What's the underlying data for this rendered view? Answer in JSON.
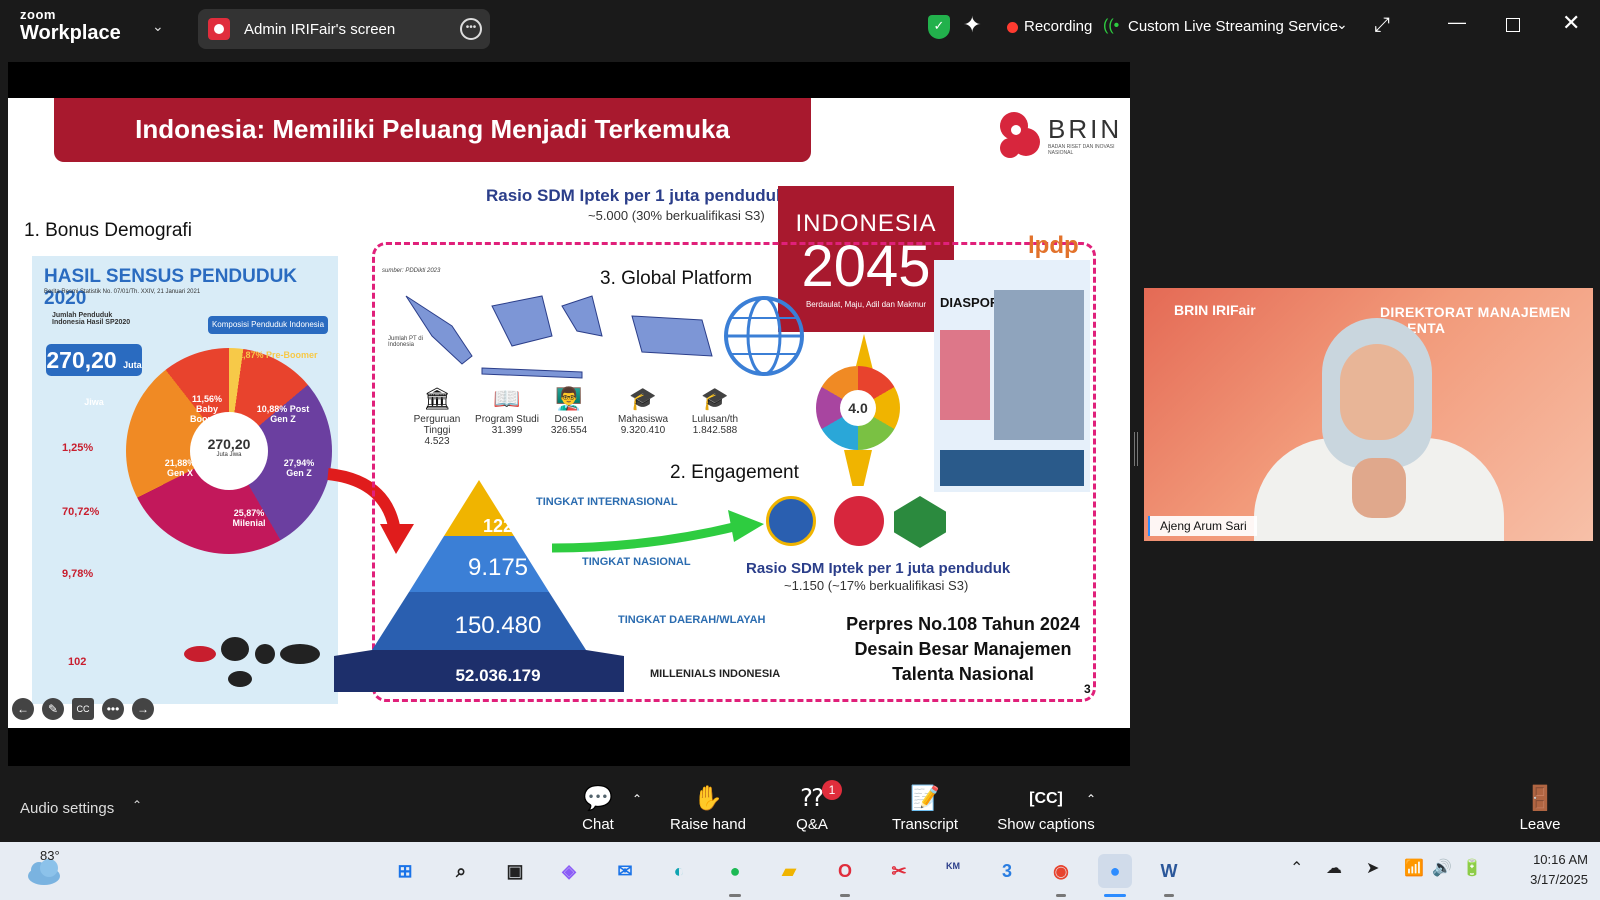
{
  "titlebar": {
    "logo_top": "zoom",
    "logo_bottom": "Workplace",
    "share_label": "Admin IRIFair's screen",
    "recording": "Recording",
    "stream": "Custom Live Streaming Service"
  },
  "slide": {
    "title": "Indonesia: Memiliki Peluang Menjadi Terkemuka",
    "brin": "BRIN",
    "brin_sub": "BADAN RISET DAN INOVASI NASIONAL",
    "ratio_top": "Rasio SDM Iptek per 1 juta penduduk",
    "ratio_top_sub": "~5.000 (30% berkualifikasi S3)",
    "indo_line1": "INDONESIA",
    "indo_line2": "2045",
    "indo_line3": "Berdaulat, Maju, Adil dan Makmur",
    "bonus": "1. Bonus Demografi",
    "census": {
      "title": "HASIL SENSUS PENDUDUK 2020",
      "subtitle": "Berita Resmi Statistik No. 07/01/Th. XXIV, 21 Januari 2021",
      "jumlah": "Jumlah Penduduk Indonesia Hasil SP2020",
      "pop": "270,20",
      "pop_unit": "Juta Jiwa",
      "komposisi": "Komposisi Penduduk Indonesia",
      "stat1": "1,25%",
      "stat2": "70,72%",
      "stat3": "9,78%",
      "stat4": "102",
      "center": "270,20",
      "center_unit": "Juta Jiwa",
      "p_preboomer": "1,87% Pre-Boomer",
      "p_baby": "11,56% Baby Boomer",
      "p_postgenz": "10,88% Post Gen Z",
      "p_genx": "21,88% Gen X",
      "p_genz": "27,94% Gen Z",
      "p_milenial": "25,87% Milenial"
    },
    "global": "3. Global Platform",
    "sumber": "sumber: PDDikti 2023",
    "jumlah_pt": "Jumlah PT di Indonesia",
    "edu": [
      {
        "label": "Perguruan Tinggi",
        "value": "4.523"
      },
      {
        "label": "Program Studi",
        "value": "31.399"
      },
      {
        "label": "Dosen",
        "value": "326.554"
      },
      {
        "label": "Mahasiswa",
        "value": "9.320.410"
      },
      {
        "label": "Lulusan/th",
        "value": "1.842.588"
      }
    ],
    "engagement": "2. Engagement",
    "pyramid": [
      "122",
      "9.175",
      "150.480",
      "52.036.179"
    ],
    "levels": [
      "TINGKAT INTERNASIONAL",
      "TINGKAT NASIONAL",
      "TINGKAT DAERAH/WLAYAH",
      "MILLENIALS INDONESIA"
    ],
    "ratio_bot": "Rasio SDM Iptek per 1 juta penduduk",
    "ratio_bot_sub": "~1.150 (~17% berkualifikasi S3)",
    "perpres1": "Perpres No.108 Tahun 2024",
    "perpres2": "Desain Besar Manajemen",
    "perpres3": "Talenta Nasional",
    "page": "3",
    "lpdp": "lpdp",
    "diaspora": "DIASPORA INDONESIA",
    "industri": "4.0"
  },
  "video": {
    "brand": "BRIN  IRIFair",
    "dir": "DIREKTORAT MANAJEMEN TALENTA",
    "name": "Ajeng Arum Sari"
  },
  "toolbar": {
    "audio": "Audio settings",
    "chat": "Chat",
    "raise": "Raise hand",
    "qa": "Q&A",
    "qa_badge": "1",
    "transcript": "Transcript",
    "captions": "Show captions",
    "leave": "Leave"
  },
  "taskbar": {
    "temp": "83°",
    "time": "10:16 AM",
    "date": "3/17/2025"
  },
  "colors": {
    "accent_red": "#a8192e",
    "zoom_blue": "#2d8cff",
    "dash_pink": "#e0207a"
  }
}
